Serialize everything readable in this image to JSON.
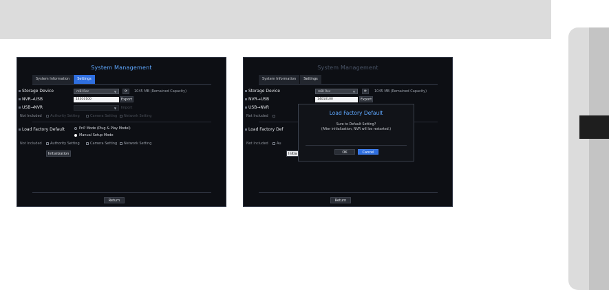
{
  "screens": [
    {
      "title": "System Management",
      "tabs": [
        "System Information",
        "Settings"
      ],
      "active_tab": 1,
      "storage_device": {
        "label": "Storage Device",
        "value": "mBI Rec",
        "capacity": "1045 MB  (Remained Capacity)"
      },
      "nvr_to_usb": {
        "label": "NVR→USB",
        "value": "14010100",
        "button": "Export"
      },
      "usb_to_nvr": {
        "label": "USB→NVR",
        "button": "Import"
      },
      "not_included_1": {
        "label": "Not Included",
        "options": [
          "Authority Setting",
          "Camera Setting",
          "Network Setting"
        ]
      },
      "load_factory": {
        "label": "Load Factory Default",
        "radio_1": "PnP Mode (Plug & Play Model)",
        "radio_2": "Manual Setup Mode",
        "selected": 2
      },
      "not_included_2": {
        "label": "Not Included",
        "options": [
          "Authority Setting",
          "Camera Setting",
          "Network Setting"
        ]
      },
      "initialization": "Initialization",
      "return": "Return"
    },
    {
      "title": "System Management",
      "tabs": [
        "System Information",
        "Settings"
      ],
      "active_tab": 1,
      "storage_device": {
        "label": "Storage Device",
        "value": "mBI Rec",
        "capacity": "1045 MB  (Remained Capacity)"
      },
      "nvr_to_usb": {
        "label": "NVR→USB",
        "value": "14010100",
        "button": "Export"
      },
      "usb_to_nvr": {
        "label": "USB→NVR"
      },
      "not_included_1": {
        "label": "Not Included"
      },
      "load_factory": {
        "label": "Load Factory Def"
      },
      "not_included_2": {
        "label": "Not Included",
        "partial": "Au"
      },
      "initialization": "Initia",
      "return": "Return",
      "dialog": {
        "title": "Load Factory Default",
        "line_1": "Sure to Default Setting?",
        "line_2": "(After initialization, NVR will be restarted.)",
        "ok": "OK",
        "cancel": "Cancel"
      }
    }
  ],
  "colors": {
    "accent": "#2f6fe0",
    "title": "#5fa8ff",
    "screen_bg": "#0d0f14",
    "frame_gray": "#dcdcdc"
  },
  "icons": {
    "refresh": "refresh-icon",
    "dropdown": "chevron-down-icon"
  }
}
